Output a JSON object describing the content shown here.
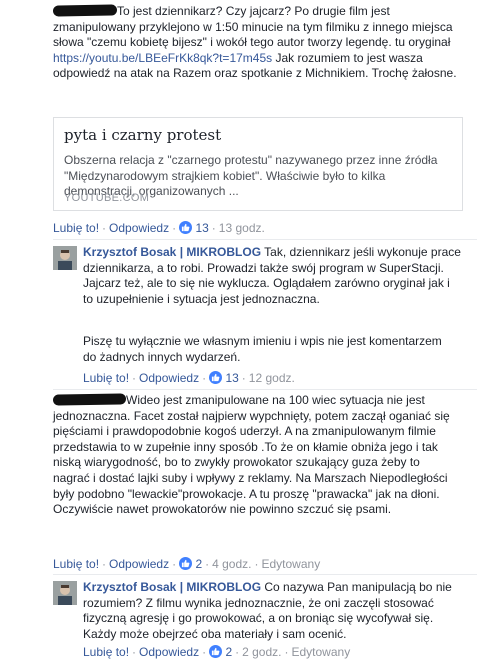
{
  "comment1": {
    "text_p1": "To jest dziennikarz? Czy jajcarz? Po drugie film jest zmanipulowany przyklejono w 1:50 minucie na tym filmiku z innego miejsca słowa \"czemu kobietę bijesz\" i wokół tego autor tworzy legendę. tu oryginał ",
    "link": "https://youtu.be/LBEeFrKk8qk?t=17m45s",
    "text_p2": " Jak rozumiem to jest wasza odpowiedź na atak na Razem oraz spotkanie z Michnikiem. Trochę żałosne.",
    "preview": {
      "title": "pyta i czarny protest",
      "description": "Obszerna relacja z \"czarnego protestu\" nazywanego przez inne źródła \"Międzynarodowym strajkiem kobiet\". Właściwie było to kilka demonstracji, organizowanych ...",
      "source": "YOUTUBE.COM"
    },
    "like_label": "Lubię to!",
    "reply_label": "Odpowiedz",
    "likes": "13",
    "time": "13 godz."
  },
  "reply1": {
    "author": "Krzysztof Bosak | MIKROBLOG",
    "text": " Tak, dziennikarz jeśli wykonuje prace dziennikarza, a to robi. Prowadzi także swój program w SuperStacji. Jajcarz też, ale to się nie wyklucza. Oglądałem zarówno oryginał jak i to uzupełnienie i sytuacja jest jednoznaczna.",
    "text2": "Piszę tu wyłącznie we własnym imieniu i wpis nie jest komentarzem do żadnych innych wydarzeń.",
    "like_label": "Lubię to!",
    "reply_label": "Odpowiedz",
    "likes": "13",
    "time": "12 godz."
  },
  "comment2": {
    "text": "Wideo jest zmanipulowane na 100 wiec sytuacja nie jest jednoznaczna. Facet został najpierw wypchnięty, potem zaczął oganiać się pięściami i prawdopodobnie kogoś uderzył. A na zmanipulowanym filmie przedstawia to w zupełnie inny sposób .To że on kłamie obniża jego i tak niską wiarygodność, bo to zwykły prowokator szukający guza żeby to nagrać i dostać lajki suby i wpływy z reklamy. Na Marszach Niepodległości były podobno \"lewackie\"prowokacje. A tu proszę \"prawacka\" jak na dłoni. Oczywiście nawet prowokatorów nie powinno szczuć się psami.",
    "like_label": "Lubię to!",
    "reply_label": "Odpowiedz",
    "likes": "2",
    "time": "4 godz.",
    "edited": "Edytowany"
  },
  "reply2": {
    "author": "Krzysztof Bosak | MIKROBLOG",
    "text": " Co nazywa Pan manipulacją bo nie rozumiem? Z filmu wynika jednoznacznie, że oni zaczęli stosować fizyczną agresję i go prowokować, a on broniąc się wycofywał się. Każdy może obejrzeć oba materiały i sam ocenić.",
    "like_label": "Lubię to!",
    "reply_label": "Odpowiedz",
    "likes": "2",
    "time": "2 godz.",
    "edited": "Edytowany"
  }
}
